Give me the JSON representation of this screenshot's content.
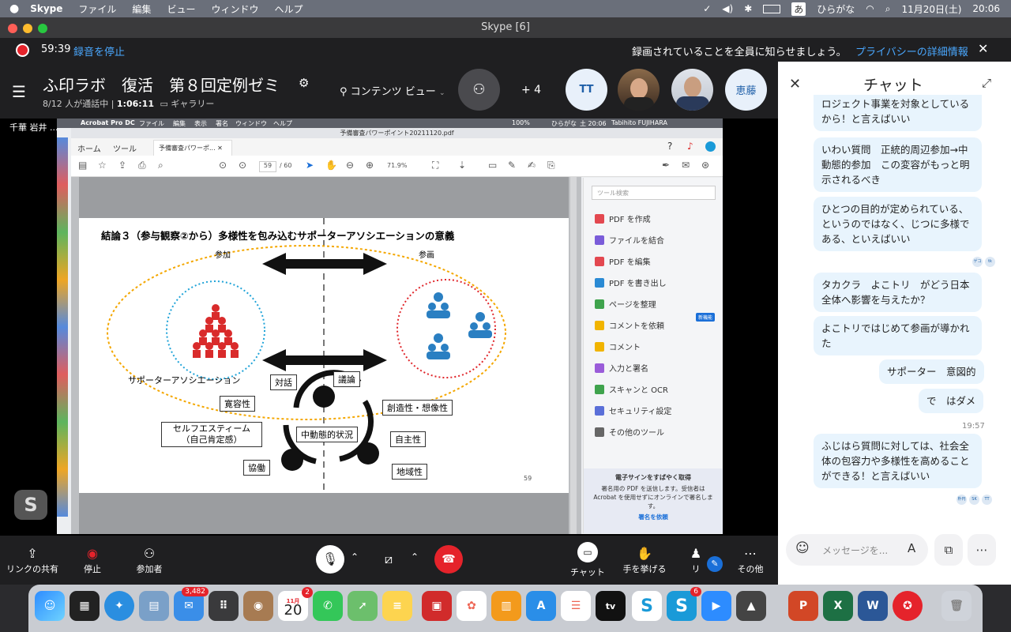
{
  "menubar": {
    "apple": "",
    "app": "Skype",
    "items": [
      "ファイル",
      "編集",
      "ビュー",
      "ウィンドウ",
      "ヘルプ"
    ],
    "ime": "ひらがな",
    "date": "11月20日(土)",
    "time": "20:06"
  },
  "window": {
    "title": "Skype [6]"
  },
  "recording": {
    "timer": "59:39",
    "stop_label": "録音を停止",
    "notice": "録画されていることを全員に知らせましょう。",
    "privacy_link": "プライバシーの詳細情報"
  },
  "call": {
    "title": "ふ印ラボ　復活　第８回定例ゼミ",
    "participants_active": "8/12",
    "status_text": " 人が通話中 | ",
    "duration": "1:06:11",
    "view_mode": "ギャラリー",
    "content_view": "コンテンツ ビュー",
    "plus_count": "+ 4",
    "avatars": [
      {
        "initials": "TT"
      },
      {
        "initials": ""
      },
      {
        "initials": ""
      },
      {
        "initials": "恵藤"
      }
    ],
    "presenter": "千華 岩井 ..."
  },
  "shared_screen": {
    "menubar": {
      "app": "Acrobat Pro DC",
      "items": [
        "ファイル",
        "編集",
        "表示",
        "署名",
        "ウィンドウ",
        "ヘルプ"
      ],
      "battery": "100%",
      "ime": "ひらがな",
      "time": "土 20:06",
      "user": "Tabihito FUJIHARA"
    },
    "doc_title": "予備審査パワーポイント20211120.pdf",
    "tabs": [
      "ホーム",
      "ツール",
      "予備審査パワーポ..."
    ],
    "page_current": "59",
    "page_total": "/ 60",
    "zoom": "71.9%",
    "slide": {
      "title": "結論３（参与観察②から）多様性を包み込むサポーターアソシエーションの意義",
      "label_left": "参加",
      "label_right": "参画",
      "association": "サポーターアソシエーション",
      "tolerance": "寛容性",
      "self_esteem_1": "セルフエスティーム",
      "self_esteem_2": "（自己肯定感）",
      "dialogue": "対話",
      "discussion": "議論",
      "creativity": "創造性・想像性",
      "autonomy": "自主性",
      "locality": "地域性",
      "cooperation": "協働",
      "center": "中動態的状況",
      "page_no": "59"
    },
    "side_panel": {
      "search_placeholder": "ツール検索",
      "tools": [
        "PDF を作成",
        "ファイルを結合",
        "PDF を編集",
        "PDF を書き出し",
        "ページを整理",
        "コメントを依頼",
        "コメント",
        "入力と署名",
        "スキャンと OCR",
        "セキュリティ設定",
        "その他のツール"
      ],
      "new_badge": "新機能",
      "esign_title": "電子サインをすばやく取得",
      "esign_body": "署名用の PDF を送信します。受信者は Acrobat を使用せずにオンラインで署名します。",
      "esign_link": "署名を依頼"
    }
  },
  "toolbar": {
    "share_link": "リンクの共有",
    "stop": "停止",
    "participants": "参加者",
    "chat": "チャット",
    "raise_hand": "手を挙げる",
    "react": "リ",
    "more": "その他"
  },
  "chat": {
    "title": "チャット",
    "messages": [
      {
        "text": "ロジェクト事業を対象としているから！と言えばいい"
      },
      {
        "text": "いわい質問　正統的周辺参加→中動態的参加　この変容がもっと明示されるべき"
      },
      {
        "text": "ひとつの目的が定められている、というのではなく、じつに多様である、といえばいい"
      },
      {
        "text": "タカクラ　よこトリ　がどう日本全体へ影響を与えたか？"
      },
      {
        "text": "よこトリではじめて参画が導かれた"
      },
      {
        "text": "サポーター　意図的"
      },
      {
        "text": "で　はダメ"
      },
      {
        "text": "ふじはら質問に対しては、社会全体の包容力や多様性を高めることができる！と言えばいい"
      }
    ],
    "reactions_1": [
      "ゲコ",
      "tk"
    ],
    "timestamp": "19:57",
    "reactions_2": [
      "朴円",
      "SK",
      "TT"
    ],
    "input_placeholder": "メッセージを..."
  },
  "dock": {
    "mail_badge": "3,482",
    "calendar_month": "11月",
    "calendar_day": "20",
    "calendar_badge": "2",
    "skype_badge": "6",
    "tv_label": "tv"
  },
  "colors": {
    "skype_blue": "#0078d4",
    "rec_red": "#e5232b",
    "chat_bubble": "#e8f4fd"
  }
}
